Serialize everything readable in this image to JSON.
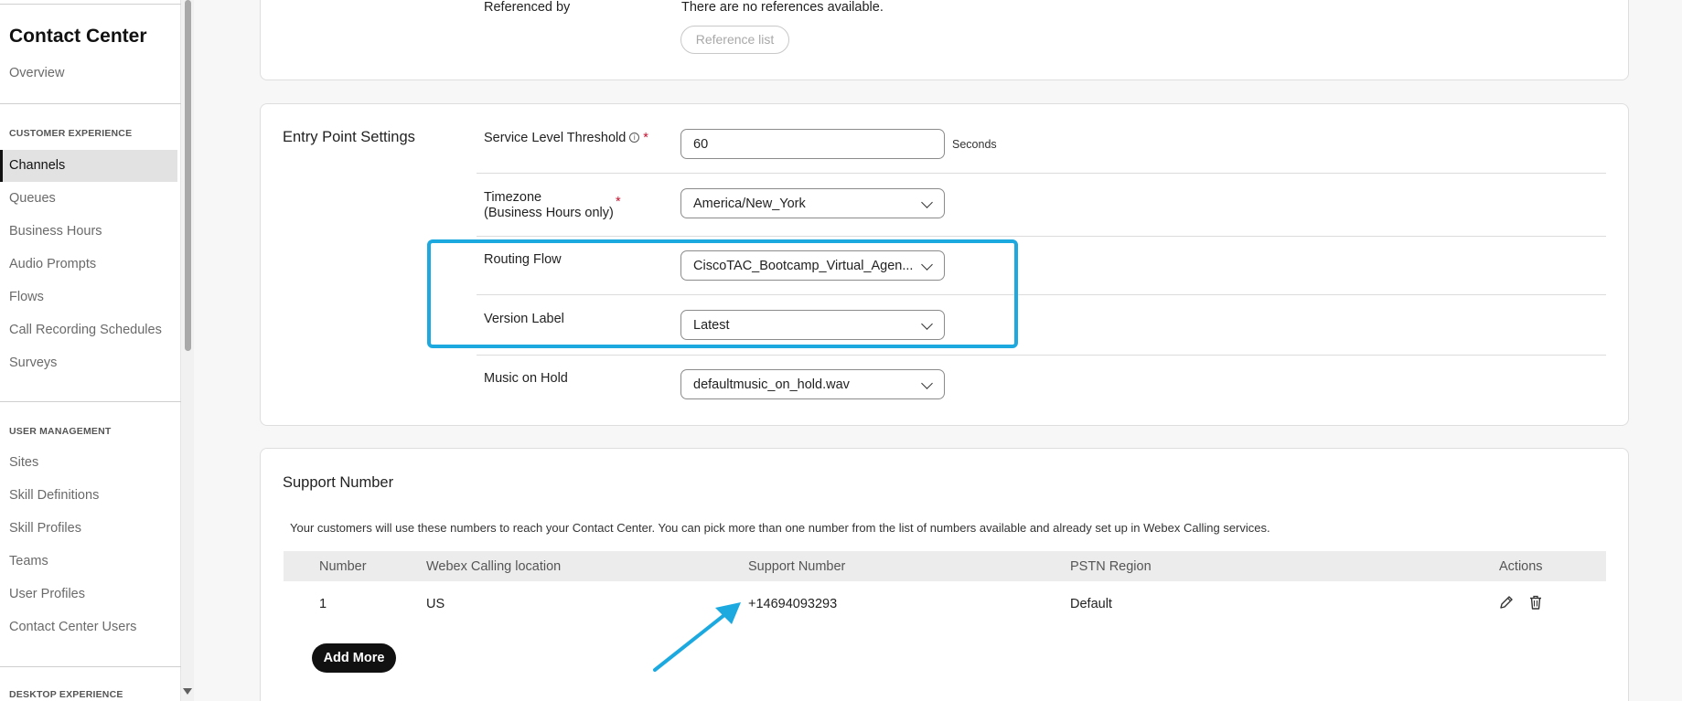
{
  "sidebar": {
    "title": "Contact Center",
    "overview": "Overview",
    "sections": {
      "customer_experience": "CUSTOMER EXPERIENCE",
      "user_management": "USER MANAGEMENT",
      "desktop_experience": "DESKTOP EXPERIENCE"
    },
    "customer_items": [
      "Channels",
      "Queues",
      "Business Hours",
      "Audio Prompts",
      "Flows",
      "Call Recording Schedules",
      "Surveys"
    ],
    "user_items": [
      "Sites",
      "Skill Definitions",
      "Skill Profiles",
      "Teams",
      "User Profiles",
      "Contact Center Users"
    ],
    "active_item": "Channels"
  },
  "references": {
    "label": "Referenced by",
    "value": "There are no references available.",
    "button": "Reference list"
  },
  "entry_point": {
    "title": "Entry Point Settings",
    "service_level": {
      "label": "Service Level Threshold",
      "value": "60",
      "units": "Seconds",
      "required": "*"
    },
    "timezone": {
      "label_line1": "Timezone",
      "label_line2": "(Business Hours only)",
      "value": "America/New_York",
      "required": "*"
    },
    "routing_flow": {
      "label": "Routing Flow",
      "value": "CiscoTAC_Bootcamp_Virtual_Agen..."
    },
    "version_label": {
      "label": "Version Label",
      "value": "Latest"
    },
    "music_on_hold": {
      "label": "Music on Hold",
      "value": "defaultmusic_on_hold.wav"
    }
  },
  "support_number": {
    "title": "Support Number",
    "description": "Your customers will use these numbers to reach your Contact Center. You can pick more than one number from the list of numbers available and already set up in Webex Calling services.",
    "columns": [
      "Number",
      "Webex Calling location",
      "Support Number",
      "PSTN Region",
      "Actions"
    ],
    "rows": [
      {
        "number": "1",
        "location": "US",
        "support_number": "+14694093293",
        "region": "Default"
      }
    ],
    "add_button": "Add More"
  },
  "colors": {
    "highlight": "#1ba9e0",
    "required": "#c4122f",
    "primary_button": "#111111"
  },
  "icons": [
    "info-icon",
    "chevron-down-icon",
    "edit-icon",
    "trash-icon",
    "arrow-annotation"
  ]
}
